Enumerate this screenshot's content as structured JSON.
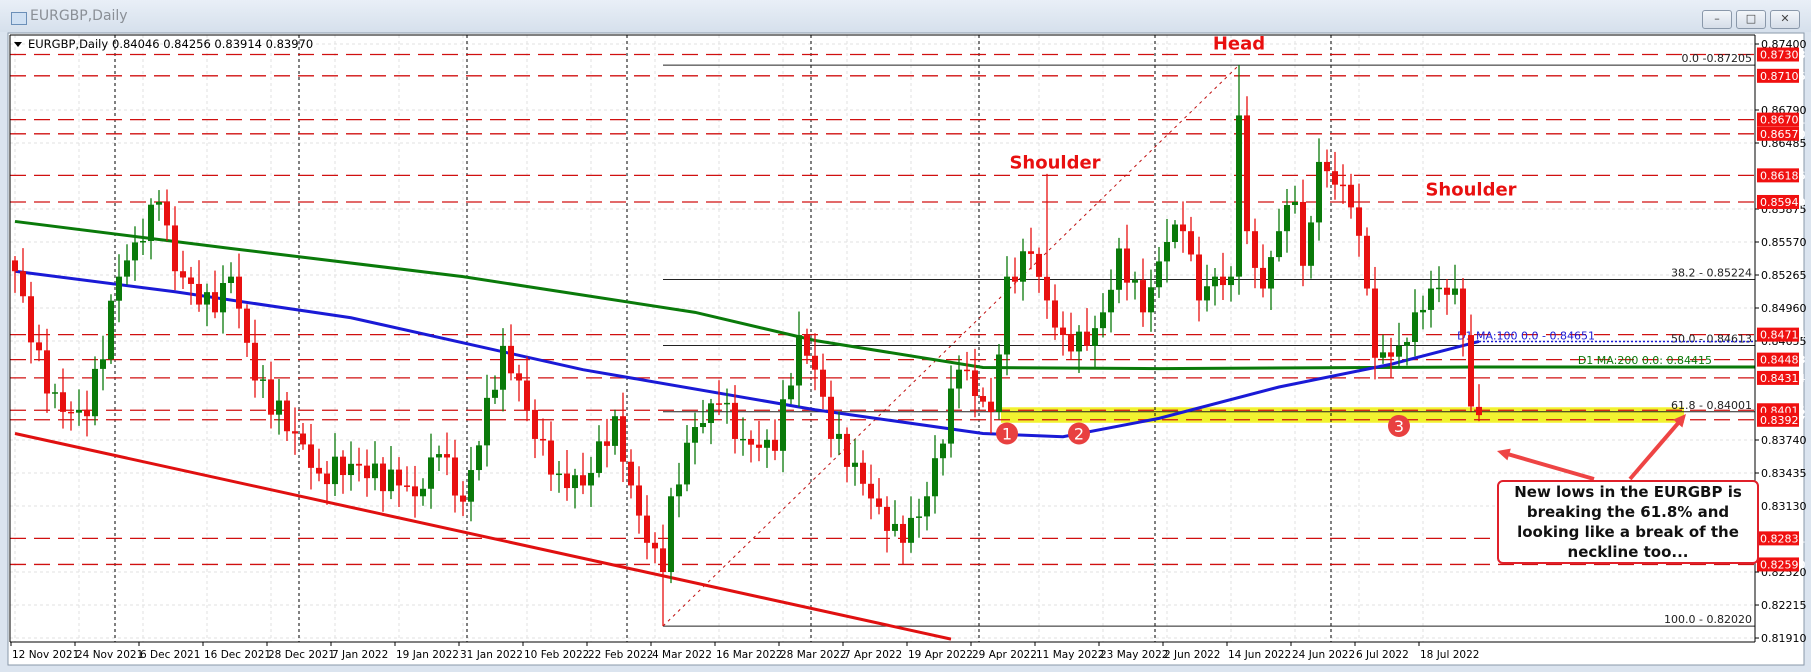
{
  "window": {
    "title": "EURGBP,Daily",
    "minimize_label": "–",
    "maximize_label": "□",
    "close_label": "✕"
  },
  "chart_data": {
    "type": "candlestick",
    "header": {
      "symbol": "EURGBP,Daily",
      "ohlc": "0.84046 0.84256 0.83914 0.83970"
    },
    "last_bar": {
      "open": 0.84046,
      "high": 0.84256,
      "low": 0.83914,
      "close": 0.8397
    },
    "bar_count": 184,
    "close_waypoints": [
      [
        0,
        0.853
      ],
      [
        4,
        0.8417
      ],
      [
        6,
        0.84
      ],
      [
        9,
        0.8396
      ],
      [
        13,
        0.8525
      ],
      [
        18,
        0.8594
      ],
      [
        20,
        0.853
      ],
      [
        25,
        0.8492
      ],
      [
        27,
        0.8525
      ],
      [
        30,
        0.8429
      ],
      [
        35,
        0.838
      ],
      [
        38,
        0.8343
      ],
      [
        42,
        0.8352
      ],
      [
        48,
        0.8332
      ],
      [
        50,
        0.8322
      ],
      [
        53,
        0.8361
      ],
      [
        56,
        0.8317
      ],
      [
        61,
        0.8461
      ],
      [
        63,
        0.8429
      ],
      [
        65,
        0.8375
      ],
      [
        68,
        0.8343
      ],
      [
        71,
        0.8332
      ],
      [
        75,
        0.8396
      ],
      [
        77,
        0.8332
      ],
      [
        79,
        0.8279
      ],
      [
        81,
        0.8252
      ],
      [
        82,
        0.8322
      ],
      [
        85,
        0.8386
      ],
      [
        88,
        0.8407
      ],
      [
        91,
        0.8375
      ],
      [
        95,
        0.8364
      ],
      [
        98,
        0.8471
      ],
      [
        100,
        0.8439
      ],
      [
        102,
        0.8375
      ],
      [
        105,
        0.8353
      ],
      [
        109,
        0.829
      ],
      [
        111,
        0.8279
      ],
      [
        114,
        0.8322
      ],
      [
        118,
        0.8439
      ],
      [
        122,
        0.84
      ],
      [
        124,
        0.8525
      ],
      [
        127,
        0.8546
      ],
      [
        129,
        0.8503
      ],
      [
        131,
        0.8471
      ],
      [
        134,
        0.8461
      ],
      [
        136,
        0.8492
      ],
      [
        138,
        0.8551
      ],
      [
        141,
        0.8492
      ],
      [
        144,
        0.8557
      ],
      [
        146,
        0.8567
      ],
      [
        148,
        0.8503
      ],
      [
        150,
        0.8525
      ],
      [
        152,
        0.8525
      ],
      [
        153,
        0.8674
      ],
      [
        154,
        0.8567
      ],
      [
        156,
        0.8514
      ],
      [
        158,
        0.8567
      ],
      [
        160,
        0.8594
      ],
      [
        161,
        0.8535
      ],
      [
        163,
        0.8631
      ],
      [
        165,
        0.861
      ],
      [
        167,
        0.8589
      ],
      [
        169,
        0.8514
      ],
      [
        170,
        0.845
      ],
      [
        173,
        0.8461
      ],
      [
        175,
        0.8492
      ],
      [
        177,
        0.8514
      ],
      [
        180,
        0.8514
      ],
      [
        181,
        0.8471
      ],
      [
        182,
        0.8405
      ],
      [
        183,
        0.8397
      ]
    ],
    "extreme_wicks": [
      [
        81,
        0.8202
      ],
      [
        153,
        0.87205
      ],
      [
        18,
        0.8605
      ],
      [
        129,
        0.862
      ],
      [
        167,
        0.862
      ]
    ],
    "ma100": {
      "label": "D1 MA:100 0.0 - 0.84651",
      "color": "#1a1ad6",
      "points": [
        [
          0,
          0.853
        ],
        [
          20,
          0.8511
        ],
        [
          42,
          0.8487
        ],
        [
          71,
          0.8439
        ],
        [
          100,
          0.8402
        ],
        [
          121,
          0.838
        ],
        [
          131,
          0.8377
        ],
        [
          143,
          0.8394
        ],
        [
          158,
          0.8423
        ],
        [
          172,
          0.8444
        ],
        [
          183,
          0.84651
        ]
      ]
    },
    "ma200": {
      "label": "D1 MA:200 0.0: 0.84415",
      "color": "#0a7a0a",
      "points": [
        [
          0,
          0.8576
        ],
        [
          27,
          0.8551
        ],
        [
          56,
          0.8525
        ],
        [
          85,
          0.8492
        ],
        [
          100,
          0.8466
        ],
        [
          121,
          0.8441
        ],
        [
          143,
          0.844
        ],
        [
          183,
          0.84415
        ]
      ]
    },
    "trendline": {
      "points": [
        [
          0,
          0.838
        ],
        [
          117,
          0.819
        ]
      ],
      "color": "#e01010"
    },
    "fibonacci": {
      "from": [
        81,
        0.8202
      ],
      "to": [
        153,
        0.87205
      ],
      "levels": [
        {
          "label": "0.0 -0.87205",
          "price": 0.87205
        },
        {
          "label": "38.2 - 0.85224",
          "price": 0.85224
        },
        {
          "label": "50.0 - 0.84613",
          "price": 0.84613
        },
        {
          "label": "61.8 - 0.84001",
          "price": 0.84001
        },
        {
          "label": "100.0 - 0.82020",
          "price": 0.8202
        }
      ]
    },
    "horizontal_levels": [
      0.87303,
      0.87106,
      0.86701,
      0.8657,
      0.86186,
      0.8594,
      0.84714,
      0.84483,
      0.84314,
      0.84015,
      0.83927,
      0.82831,
      0.8259
    ],
    "horizontal_level_labels": [
      "0.87303",
      "0.87106",
      "0.86701",
      "0.86570",
      "0.86186",
      "0.85940",
      "0.84714",
      "0.84483",
      "0.84314",
      "0.84015",
      "0.83927",
      "0.82831",
      "0.82590"
    ],
    "support_zone": {
      "from_bar": 124,
      "high": 0.84015,
      "low": 0.83927,
      "color": "#f2f230"
    },
    "y_ticks": [
      "0.87400",
      "0.86790",
      "0.86485",
      "0.85875",
      "0.85570",
      "0.85265",
      "0.84960",
      "0.84655",
      "0.83740",
      "0.83435",
      "0.83130",
      "0.82520",
      "0.82215",
      "0.81910"
    ],
    "ylim": [
      0.8191,
      0.874
    ],
    "x_ticks": [
      [
        0,
        "12 Nov 2021"
      ],
      [
        8,
        "24 Nov 2021"
      ],
      [
        16,
        "6 Dec 2021"
      ],
      [
        24,
        "16 Dec 2021"
      ],
      [
        32,
        "28 Dec 2021"
      ],
      [
        40,
        "7 Jan 2022"
      ],
      [
        48,
        "19 Jan 2022"
      ],
      [
        56,
        "31 Jan 2022"
      ],
      [
        64,
        "10 Feb 2022"
      ],
      [
        72,
        "22 Feb 2022"
      ],
      [
        80,
        "4 Mar 2022"
      ],
      [
        88,
        "16 Mar 2022"
      ],
      [
        96,
        "28 Mar 2022"
      ],
      [
        104,
        "7 Apr 2022"
      ],
      [
        112,
        "19 Apr 2022"
      ],
      [
        120,
        "29 Apr 2022"
      ],
      [
        128,
        "11 May 2022"
      ],
      [
        136,
        "23 May 2022"
      ],
      [
        144,
        "2 Jun 2022"
      ],
      [
        152,
        "14 Jun 2022"
      ],
      [
        160,
        "24 Jun 2022"
      ],
      [
        168,
        "6 Jul 2022"
      ],
      [
        176,
        "18 Jul 2022"
      ]
    ],
    "period_separators": [
      13,
      36,
      57,
      77,
      100,
      121,
      143,
      165
    ],
    "annotations": [
      {
        "text": "Head",
        "bar": 153,
        "price": 0.8735
      },
      {
        "text": "Shoulder",
        "bar": 130,
        "price": 0.8625
      },
      {
        "text": "Shoulder",
        "bar": 182,
        "price": 0.86
      }
    ],
    "markers": [
      {
        "label": "1",
        "bar": 124,
        "price": 0.838
      },
      {
        "label": "2",
        "bar": 133,
        "price": 0.838
      },
      {
        "label": "3",
        "bar": 173,
        "price": 0.8387
      }
    ],
    "callout": "New lows in the EURGBP is breaking the 61.8% and looking like a break of the neckline too...",
    "colors": {
      "bull": "#0a7a0a",
      "bear": "#e81010",
      "level": "#d01010"
    }
  }
}
